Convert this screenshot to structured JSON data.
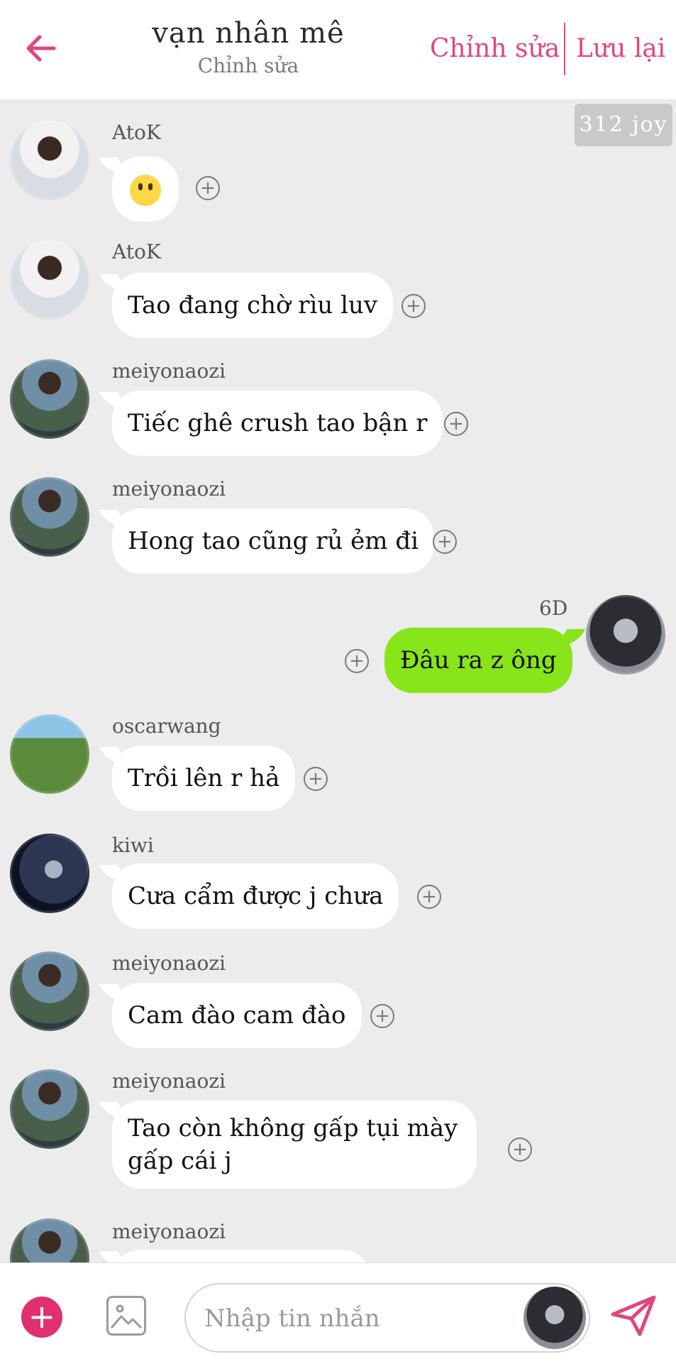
{
  "header": {
    "title": "vạn nhân mê",
    "subtitle": "Chỉnh sửa",
    "edit_label": "Chỉnh sửa",
    "save_label": "Lưu lại"
  },
  "watermark": "312 joy",
  "messages": [
    {
      "sender": "AtoK",
      "text": "😀",
      "avatar": "atok"
    },
    {
      "sender": "AtoK",
      "text": "Tao đang chờ rìu luv",
      "avatar": "atok"
    },
    {
      "sender": "meiyonaozi",
      "text": "Tiếc ghê crush tao bận r",
      "avatar": "mei"
    },
    {
      "sender": "meiyonaozi",
      "text": "Hong tao cũng rủ ẻm đi",
      "avatar": "mei"
    },
    {
      "sender": "6D",
      "text": "Đâu ra z ông",
      "mine": true
    },
    {
      "sender": "oscarwang",
      "text": "Trồi lên r hả",
      "avatar": "oscar"
    },
    {
      "sender": "kiwi",
      "text": "Cưa cẩm được j chưa",
      "avatar": "kiwi"
    },
    {
      "sender": "meiyonaozi",
      "text": "Cam đào cam đào",
      "avatar": "mei"
    },
    {
      "sender": "meiyonaozi",
      "text": "Tao còn không gấp tụi mày gấp cái j",
      "avatar": "mei"
    },
    {
      "sender": "meiyonaozi",
      "text": "",
      "avatar": "mei"
    }
  ],
  "composer": {
    "placeholder": "Nhập tin nhắn",
    "value": ""
  },
  "colors": {
    "accent": "#e0467c",
    "my_bubble": "#88e51a",
    "chat_bg": "#ececec"
  }
}
